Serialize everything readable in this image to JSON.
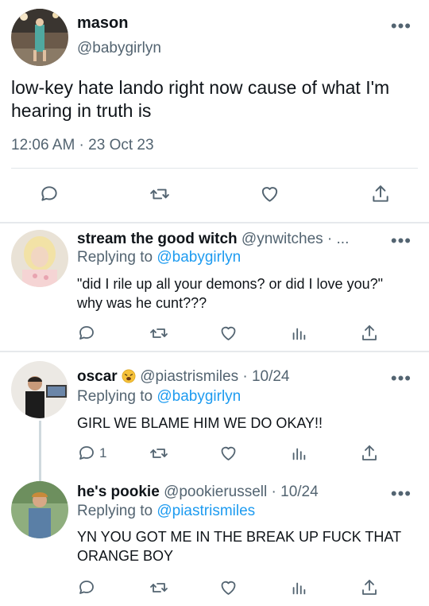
{
  "main": {
    "name": "mason",
    "handle": "@babygirlyn",
    "text": "low-key hate lando right now cause of what I'm hearing in truth is",
    "timestamp": "12:06 AM · 23 Oct 23",
    "more_icon": "more-horizontal-icon"
  },
  "replies": [
    {
      "name": "stream the good witch",
      "handle": "@ynwitches · ...",
      "replying_label": "Replying to",
      "replying_to": "@babygirlyn",
      "text": "\"did I rile up all your demons? or did I love you?\" why was he cunt???",
      "reply_count": ""
    },
    {
      "name": "oscar",
      "emoji": "weary-face",
      "handle": "@piastrismiles · 10/24",
      "replying_label": "Replying to",
      "replying_to": "@babygirlyn",
      "text": "GIRL WE BLAME HIM WE DO OKAY!!",
      "reply_count": "1"
    },
    {
      "name": "he's pookie",
      "handle": "@pookierussell · 10/24",
      "replying_label": "Replying to",
      "replying_to": "@piastrismiles",
      "text": "YN YOU GOT ME IN THE BREAK UP FUCK THAT ORANGE BOY",
      "reply_count": ""
    }
  ],
  "colors": {
    "text": "#0f1419",
    "secondary": "#536471",
    "link": "#1d9bf0",
    "divider": "#e6e9ec"
  }
}
